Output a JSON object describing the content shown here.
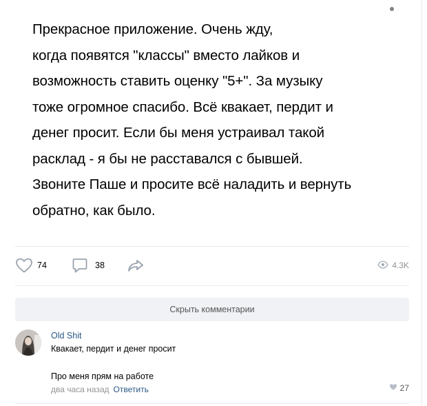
{
  "post": {
    "text_lines": [
      "Прекрасное приложение. Очень жду,",
      "когда появятся \"классы\" вместо лайков и",
      "возможность ставить оценку \"5+\". За музыку",
      "тоже огромное спасибо. Всё квакает, пердит и",
      "денег просит. Если бы меня устраивал такой",
      "расклад - я бы не расставался с бывшей.",
      "Звоните Паше и просите всё наладить и вернуть",
      "обратно, как было."
    ],
    "likes": "74",
    "comments": "38",
    "views": "4.3K"
  },
  "hide_comments_label": "Скрыть комментарии",
  "comment": {
    "author": "Old Shit",
    "text_line_1": "Квакает, пердит и денег просит",
    "text_line_2": "Про меня прям на работе",
    "time": "два часа назад",
    "reply_label": "Ответить",
    "likes": "27"
  },
  "colors": {
    "link": "#2a5885",
    "muted": "#939393",
    "icon": "#99a2ad",
    "button_bg": "#f0f2f5",
    "divider": "#e7e8ec"
  },
  "icons": {
    "like": "heart-icon",
    "comment": "comment-bubble-icon",
    "share": "share-arrow-icon",
    "views": "eye-icon",
    "more": "more-dot-icon"
  }
}
